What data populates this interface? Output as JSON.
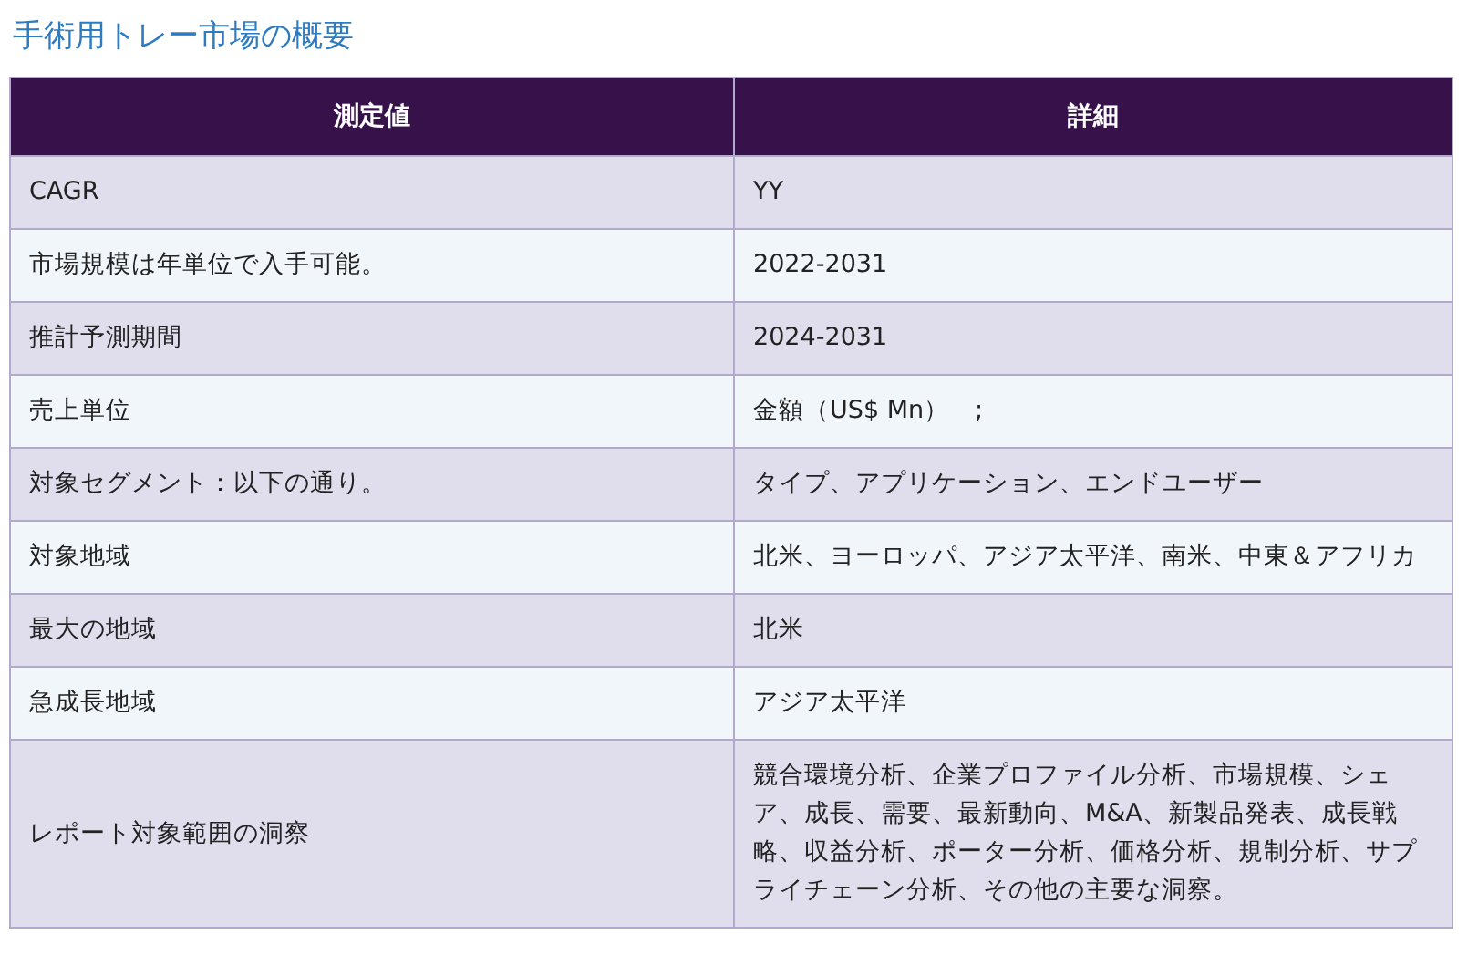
{
  "title": "手術用トレー市場の概要",
  "table": {
    "columns": [
      "測定値",
      "詳細"
    ],
    "rows": [
      {
        "cells": [
          "CAGR",
          "YY"
        ]
      },
      {
        "cells": [
          "市場規模は年単位で入手可能。",
          "2022-2031"
        ]
      },
      {
        "cells": [
          "推計予測期間",
          "2024-2031"
        ]
      },
      {
        "cells": [
          "売上単位",
          "金額（US$ Mn）　;"
        ]
      },
      {
        "cells": [
          "対象セグメント：以下の通り。",
          "タイプ、アプリケーション、エンドユーザー"
        ]
      },
      {
        "cells": [
          "対象地域",
          "北米、ヨーロッパ、アジア太平洋、南米、中東＆アフリカ"
        ]
      },
      {
        "cells": [
          "最大の地域",
          "北米"
        ]
      },
      {
        "cells": [
          "急成長地域",
          "アジア太平洋"
        ]
      },
      {
        "cells": [
          "レポート対象範囲の洞察",
          "競合環境分析、企業プロファイル分析、市場規模、シェア、成長、需要、最新動向、M&A、新製品発表、成長戦略、収益分析、ポーター分析、価格分析、規制分析、サプライチェーン分析、その他の主要な洞察。"
        ]
      }
    ]
  }
}
